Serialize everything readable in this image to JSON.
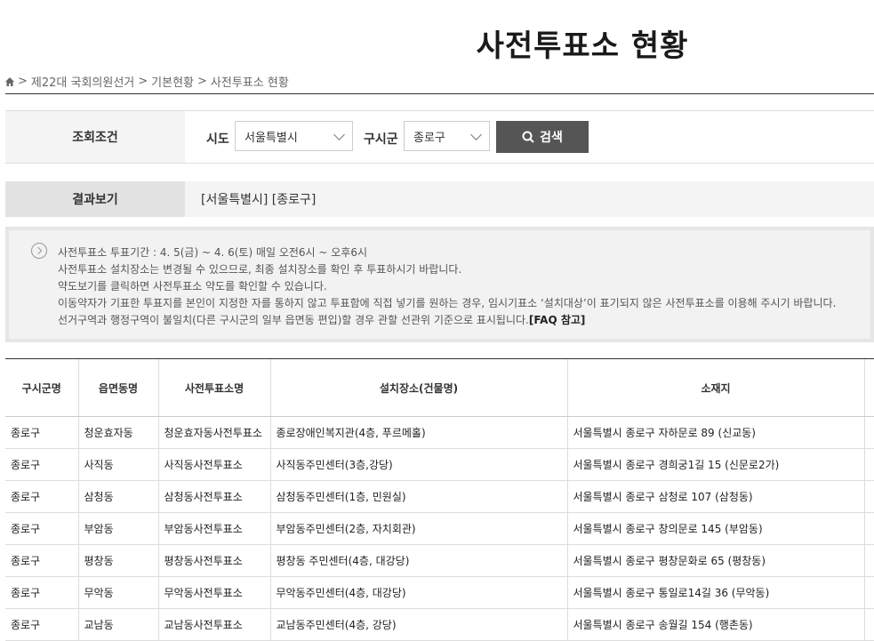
{
  "page": {
    "title": "사전투표소 현황"
  },
  "breadcrumb": {
    "items": [
      "제22대 국회의원선거",
      "기본현황",
      "사전투표소 현황"
    ],
    "sep": ">"
  },
  "search": {
    "label": "조회조건",
    "sido_label": "시도",
    "sido_value": "서울특별시",
    "gu_label": "구시군",
    "gu_value": "종로구",
    "button_label": "검색"
  },
  "result": {
    "label": "결과보기",
    "value": "[서울특별시] [종로구]"
  },
  "notice": {
    "lines": [
      "사전투표소 투표기간 : 4. 5(금) ~ 4. 6(토) 매일 오전6시 ~ 오후6시",
      "사전투표소 설치장소는 변경될 수 있으므로, 최종 설치장소를 확인 후 투표하시기 바랍니다.",
      "약도보기를 클릭하면 사전투표소 약도를 확인할 수 있습니다.",
      "이동약자가 기표한 투표지를 본인이 지정한 자를 통하지 않고 투표함에 직접 넣기를 원하는 경우, 임시기표소 ‘설치대상’이 표기되지 않은 사전투표소를 이용해 주시기 바랍니다."
    ],
    "last_line": "선거구역과 행정구역이 불일치(다른 구시군의 일부 읍면동 편입)할 경우 관할 선관위 기준으로 표시됩니다.",
    "faq": "[FAQ 참고]"
  },
  "table": {
    "headers": [
      "구시군명",
      "읍면동명",
      "사전투표소명",
      "설치장소(건물명)",
      "소재지",
      ""
    ],
    "rows": [
      [
        "종로구",
        "청운효자동",
        "청운효자동사전투표소",
        "종로장애인복지관(4층, 푸르메홀)",
        "서울특별시 종로구 자하문로 89 (신교동)",
        ""
      ],
      [
        "종로구",
        "사직동",
        "사직동사전투표소",
        "사직동주민센터(3층,강당)",
        "서울특별시 종로구 경희궁1길 15 (신문로2가)",
        ""
      ],
      [
        "종로구",
        "삼청동",
        "삼청동사전투표소",
        "삼청동주민센터(1층, 민원실)",
        "서울특별시 종로구 삼청로 107 (삼청동)",
        ""
      ],
      [
        "종로구",
        "부암동",
        "부암동사전투표소",
        "부암동주민센터(2층, 자치회관)",
        "서울특별시 종로구 창의문로 145 (부암동)",
        ""
      ],
      [
        "종로구",
        "평창동",
        "평창동사전투표소",
        "평창동 주민센터(4층, 대강당)",
        "서울특별시 종로구 평창문화로 65 (평창동)",
        ""
      ],
      [
        "종로구",
        "무악동",
        "무악동사전투표소",
        "무악동주민센터(4층, 대강당)",
        "서울특별시 종로구 통일로14길 36 (무악동)",
        ""
      ],
      [
        "종로구",
        "교남동",
        "교남동사전투표소",
        "교남동주민센터(4층, 강당)",
        "서울특별시 종로구 송월길 154 (행촌동)",
        ""
      ]
    ]
  }
}
